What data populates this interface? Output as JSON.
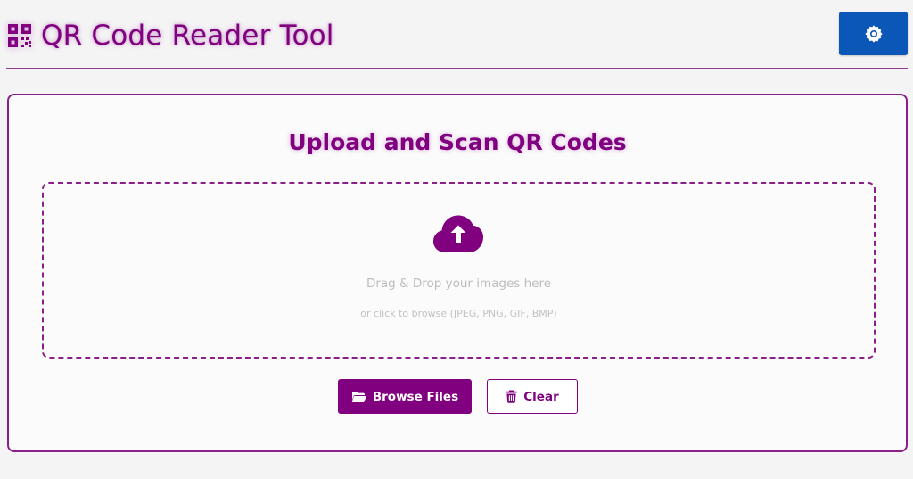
{
  "header": {
    "title": "QR Code Reader Tool",
    "icon": "qrcode-icon",
    "settings_icon": "gear-icon"
  },
  "main": {
    "title": "Upload and Scan QR Codes",
    "dropzone": {
      "icon": "cloud-upload-icon",
      "primary_text": "Drag & Drop your images here",
      "secondary_text": "or click to browse (JPEG, PNG, GIF, BMP)"
    },
    "buttons": {
      "browse_label": "Browse Files",
      "browse_icon": "folder-open-icon",
      "clear_label": "Clear",
      "clear_icon": "trash-icon"
    }
  },
  "colors": {
    "brand": "#800080",
    "settings_button": "#0b57b8",
    "background": "#f5f4f5"
  }
}
